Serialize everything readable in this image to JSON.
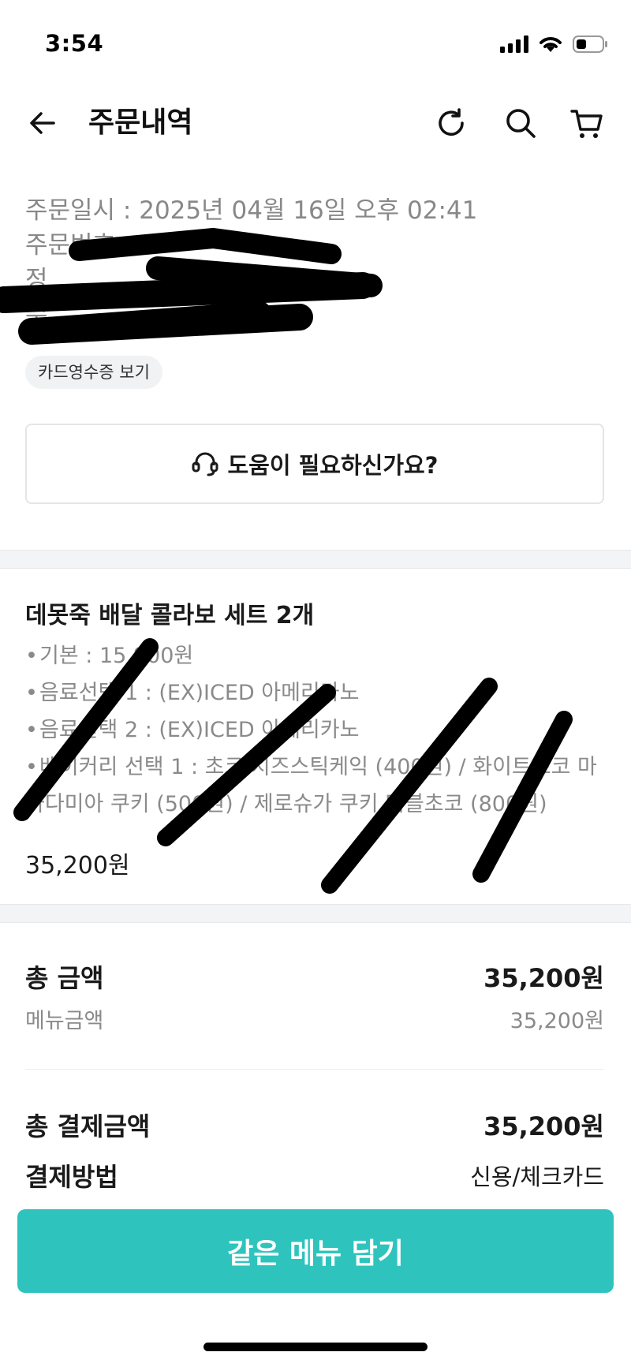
{
  "status_bar": {
    "time": "3:54"
  },
  "header": {
    "title": "주문내역",
    "icons": [
      "back-arrow-icon",
      "refresh-icon",
      "search-icon",
      "cart-icon"
    ]
  },
  "order": {
    "datetime_line": "주문일시 : 2025년 04월 16일 오후 02:41",
    "number_line": "주문번호",
    "line3": "정",
    "line4": "수",
    "receipt_button": "카드영수증 보기"
  },
  "help": {
    "label": "도움이 필요하신가요?",
    "icon": "headset-icon"
  },
  "product": {
    "title": "데못죽 배달 콜라보 세트 2개",
    "options": [
      "기본 : 15,900원",
      "음료선택 1 : (EX)ICED 아메리카노",
      "음료선택 2 : (EX)ICED 아메리카노",
      "베이커리 선택 1 : 초코 치즈스틱케익 (400원) / 화이트초코 마카다미아 쿠키 (500원) / 제로슈가 쿠키 더블초코 (800원)"
    ],
    "price": "35,200원"
  },
  "summary": {
    "total_label": "총 금액",
    "total_value": "35,200원",
    "menu_label": "메뉴금액",
    "menu_value": "35,200원",
    "pay_total_label": "총 결제금액",
    "pay_total_value": "35,200원",
    "method_label": "결제방법",
    "method_value": "신용/체크카드"
  },
  "cta": {
    "label": "같은 메뉴 담기"
  },
  "colors": {
    "accent": "#2ec4bd",
    "muted_text": "#888888",
    "divider": "#f3f4f6"
  }
}
